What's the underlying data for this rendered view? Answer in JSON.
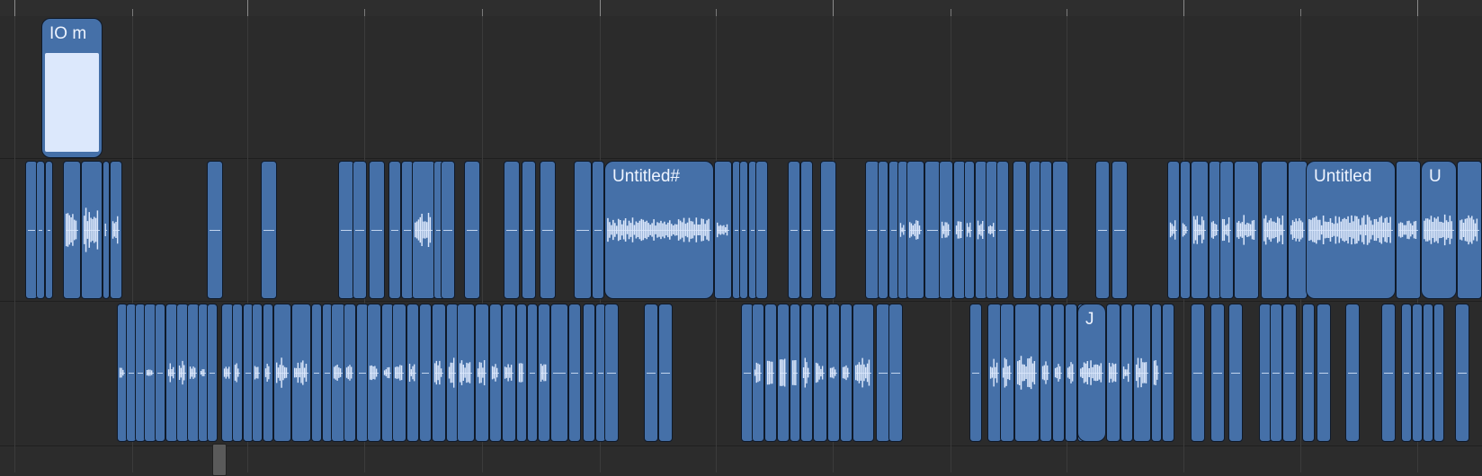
{
  "regions": {
    "io_label": "IO m",
    "untitled_hash_label": "Untitled#",
    "untitled_label": "Untitled",
    "u_label": "U",
    "j_label": "J"
  },
  "colors": {
    "background": "#2c2c2c",
    "region_fill": "#4570a8",
    "region_border": "#0f1a2a",
    "waveform": "#dce8fc"
  },
  "icons": {
    "playhead": "playhead-handle"
  }
}
